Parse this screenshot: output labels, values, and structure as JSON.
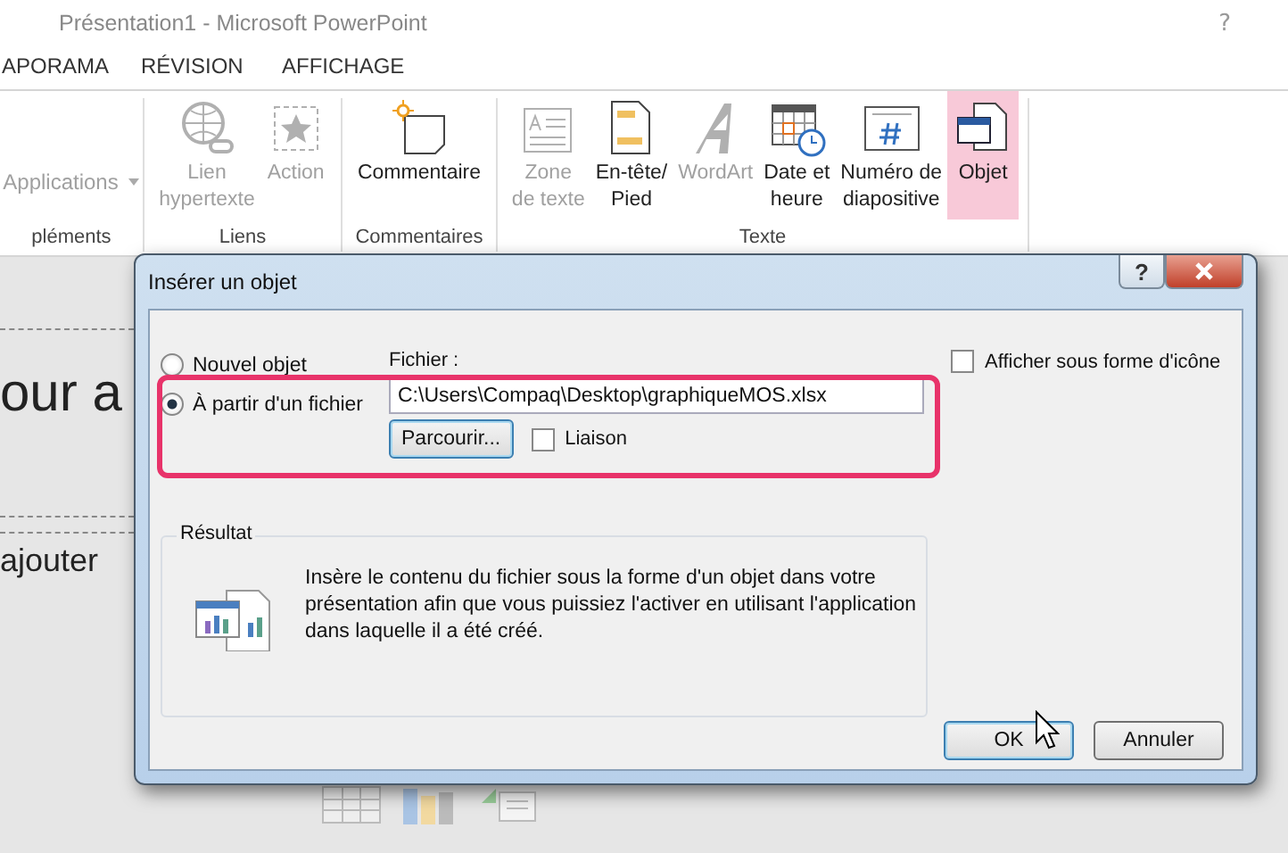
{
  "window": {
    "title": "Présentation1 - Microsoft PowerPoint",
    "help": "?"
  },
  "tabs": [
    {
      "label": "APORAMA",
      "selected": false
    },
    {
      "label": "RÉVISION",
      "selected": false
    },
    {
      "label": "AFFICHAGE",
      "selected": false
    }
  ],
  "ribbon": [
    {
      "label": "pléments",
      "items": [
        {
          "kind": "dropdown",
          "label": "Applications",
          "disabled": true,
          "selected": false
        }
      ]
    },
    {
      "label": "Liens",
      "items": [
        {
          "kind": "globe",
          "lines": [
            "Lien",
            "hypertexte"
          ],
          "disabled": true,
          "selected": false
        },
        {
          "kind": "action",
          "lines": [
            "Action"
          ],
          "disabled": true,
          "selected": false
        }
      ]
    },
    {
      "label": "Commentaires",
      "items": [
        {
          "kind": "comment",
          "lines": [
            "Commentaire"
          ],
          "disabled": false,
          "selected": false
        }
      ]
    },
    {
      "label": "Texte",
      "items": [
        {
          "kind": "textbox",
          "lines": [
            "Zone",
            "de texte"
          ],
          "disabled": true,
          "selected": false
        },
        {
          "kind": "header",
          "lines": [
            "En-tête/",
            "Pied"
          ],
          "disabled": false,
          "selected": false
        },
        {
          "kind": "wordart",
          "lines": [
            "WordArt"
          ],
          "disabled": true,
          "selected": false
        },
        {
          "kind": "calendar",
          "lines": [
            "Date et",
            "heure"
          ],
          "disabled": false,
          "selected": false
        },
        {
          "kind": "number",
          "lines": [
            "Numéro de",
            "diapositive"
          ],
          "disabled": false,
          "selected": false
        },
        {
          "kind": "object",
          "lines": [
            "Objet"
          ],
          "disabled": false,
          "selected": true
        }
      ]
    }
  ],
  "slide": {
    "title": "our a",
    "body": "ajouter"
  },
  "dialog": {
    "title": "Insérer un objet",
    "help": "?",
    "options": [
      {
        "label": "Nouvel objet",
        "selected": false
      },
      {
        "label": "À partir d'un fichier",
        "selected": true
      }
    ],
    "file_label": "Fichier :",
    "file_value": "C:\\Users\\Compaq\\Desktop\\graphiqueMOS.xlsx",
    "browse": "Parcourir...",
    "link": {
      "label": "Liaison",
      "checked": false
    },
    "as_icon": {
      "label": "Afficher sous forme d'icône",
      "checked": false
    },
    "result_label": "Résultat",
    "result_text": "Insère le contenu du fichier sous la forme d'un objet dans votre présentation afin que vous puissiez l'activer en utilisant l'application dans laquelle il a été créé.",
    "buttons": [
      "OK",
      "Annuler"
    ]
  }
}
